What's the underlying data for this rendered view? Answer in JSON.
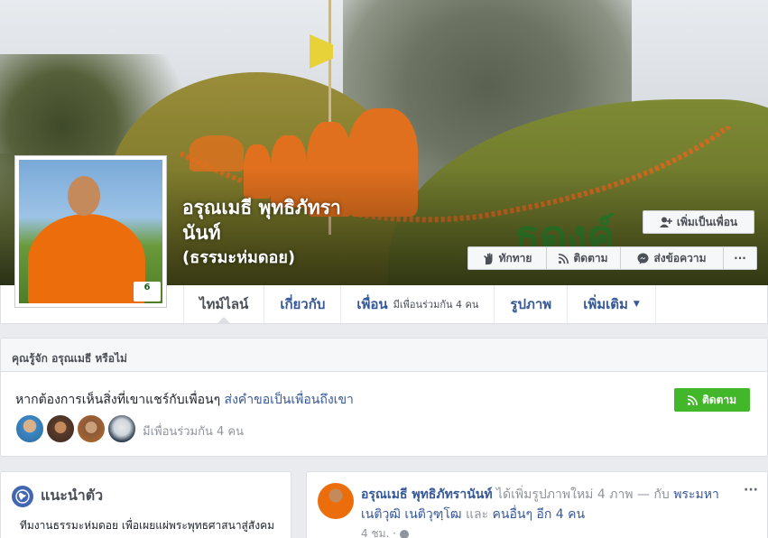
{
  "profile": {
    "name_line1": "อรุณเมธี พุทธิภัทรา",
    "name_line2": "นันท์",
    "name_line3": "(ธรรมะห่มดอย)",
    "avatar_badge": "6"
  },
  "cover_buttons": {
    "add_friend": "เพิ่มเป็นเพื่อน",
    "poke": "ทักทาย",
    "follow": "ติดตาม",
    "message": "ส่งข้อความ",
    "more": "···"
  },
  "tabs": [
    {
      "label": "ไทม์ไลน์",
      "active": true
    },
    {
      "label": "เกี่ยวกับ",
      "active": false
    },
    {
      "label": "เพื่อน",
      "extra": "มีเพื่อนร่วมกัน 4 คน",
      "active": false
    },
    {
      "label": "รูปภาพ",
      "active": false
    },
    {
      "label": "เพิ่มเติม",
      "active": false
    }
  ],
  "know_card": {
    "title": "คุณรู้จัก อรุณเมธี หรือไม่",
    "message": "หากต้องการเห็นสิ่งที่เขาแชร์กับเพื่อนๆ",
    "link": "ส่งคำขอเป็นเพื่อนถึงเขา",
    "follow_button": "ติดตาม",
    "mutual": "มีเพื่อนร่วมกัน 4 คน"
  },
  "intro": {
    "title": "แนะนำตัว",
    "text": "ทีมงานธรรมะห่มดอย เพื่อเผยแผ่พระพุทธศาสนาสู่สังคม"
  },
  "post": {
    "author": "อรุณเมธี พุทธิภัทรานันท์",
    "action": "ได้เพิ่มรูปภาพใหม่ 4 ภาพ — กับ",
    "tagged": "พระมหาเนติวุฒิ เนติวุฑฺโฒ",
    "and": "และ",
    "others": "คนอื่นๆ อีก 4 คน",
    "time": "4 ชม. ·",
    "more": "···"
  },
  "colors": {
    "link": "#365899",
    "follow_green": "#42b72a",
    "page_bg": "#e9ebee",
    "robe_orange": "#ec6d0b"
  }
}
